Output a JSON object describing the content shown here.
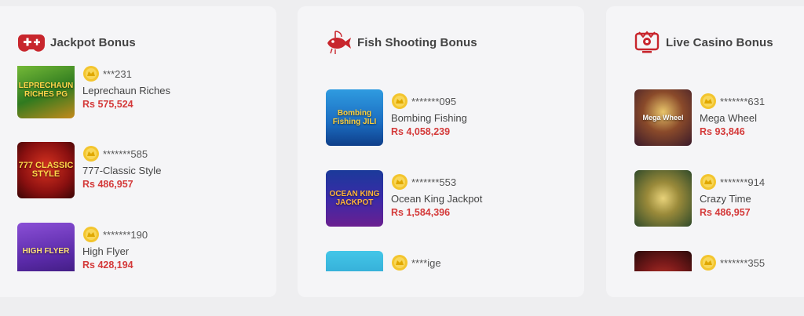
{
  "cards": [
    {
      "title": "Jackpot Bonus",
      "icon": "gamepad-icon",
      "items": [
        {
          "user": "***231",
          "game": "Leprechaun Riches",
          "amount": "Rs 575,524",
          "thumb_text": "LEPRECHAUN RICHES PG"
        },
        {
          "user": "*******585",
          "game": "777-Classic Style",
          "amount": "Rs 486,957",
          "thumb_text": "777 CLASSIC STYLE"
        },
        {
          "user": "*******190",
          "game": "High Flyer",
          "amount": "Rs 428,194",
          "thumb_text": "HIGH FLYER"
        }
      ]
    },
    {
      "title": "Fish Shooting Bonus",
      "icon": "fish-icon",
      "items": [
        {
          "user": "*******095",
          "game": "Bombing Fishing",
          "amount": "Rs 4,058,239",
          "thumb_text": "Bombing Fishing JILI"
        },
        {
          "user": "*******553",
          "game": "Ocean King Jackpot",
          "amount": "Rs 1,584,396",
          "thumb_text": "OCEAN KING JACKPOT"
        },
        {
          "user": "****ige",
          "game": "",
          "amount": "",
          "thumb_text": ""
        }
      ]
    },
    {
      "title": "Live Casino Bonus",
      "icon": "live-casino-icon",
      "items": [
        {
          "user": "*******631",
          "game": "Mega Wheel",
          "amount": "Rs 93,846",
          "thumb_text": "Mega Wheel"
        },
        {
          "user": "*******914",
          "game": "Crazy Time",
          "amount": "Rs 486,957",
          "thumb_text": ""
        },
        {
          "user": "*******355",
          "game": "",
          "amount": "",
          "thumb_text": ""
        }
      ]
    }
  ],
  "colors": {
    "accent": "#d43a3a",
    "card_bg": "#f5f5f7",
    "page_bg": "#eeeef0"
  }
}
